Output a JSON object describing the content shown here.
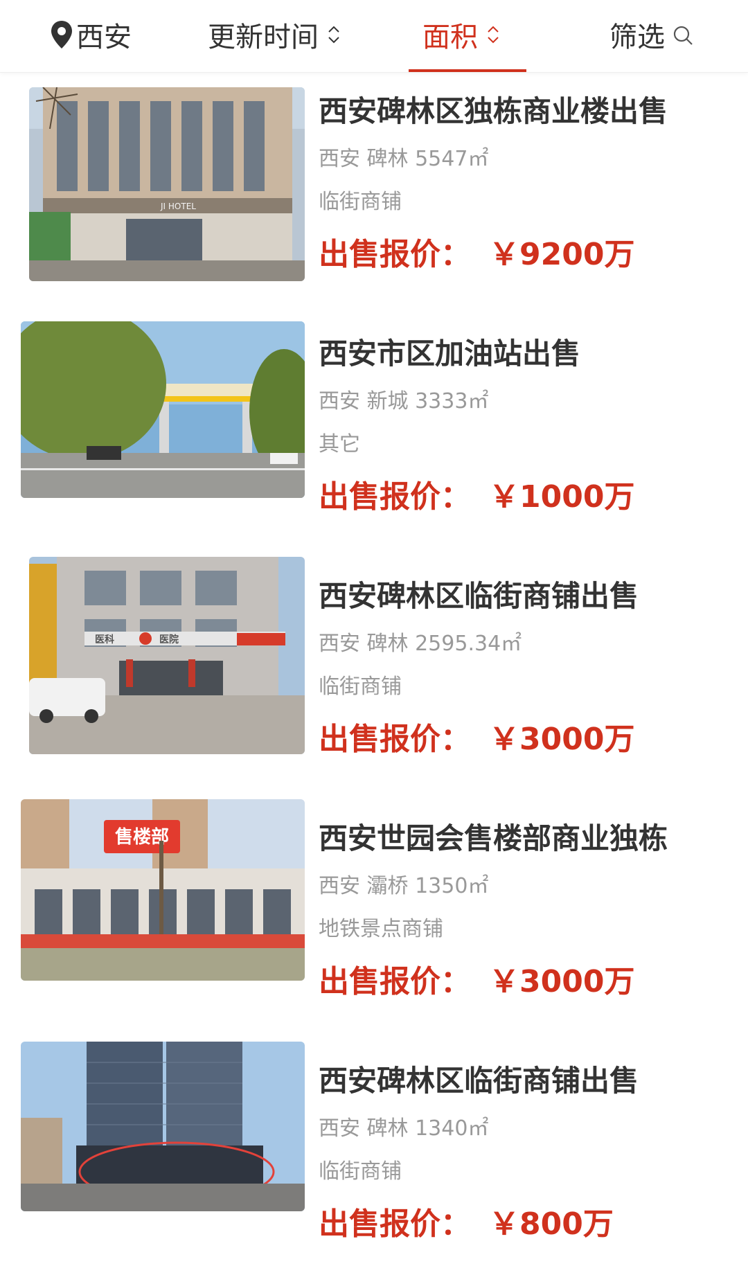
{
  "topbar": {
    "city": "西安",
    "sort_update": "更新时间",
    "sort_area": "面积",
    "filter": "筛选",
    "active_color": "#d0311d"
  },
  "price_label": "出售报价：",
  "listings": [
    {
      "title": "西安碑林区独栋商业楼出售",
      "city": "西安",
      "district": "碑林",
      "area": "5547㎡",
      "type": "临街商铺",
      "price": "￥9200万"
    },
    {
      "title": "西安市区加油站出售",
      "city": "西安",
      "district": "新城",
      "area": "3333㎡",
      "type": "其它",
      "price": "￥1000万"
    },
    {
      "title": "西安碑林区临街商铺出售",
      "city": "西安",
      "district": "碑林",
      "area": "2595.34㎡",
      "type": "临街商铺",
      "price": "￥3000万"
    },
    {
      "title": "西安世园会售楼部商业独栋",
      "city": "西安",
      "district": "灞桥",
      "area": "1350㎡",
      "type": "地铁景点商铺",
      "price": "￥3000万",
      "photo_badge": "售楼部"
    },
    {
      "title": "西安碑林区临街商铺出售",
      "city": "西安",
      "district": "碑林",
      "area": "1340㎡",
      "type": "临街商铺",
      "price": "￥800万"
    }
  ],
  "photo_signage": {
    "hotel": "JI HOTEL",
    "hospital_left": "医科",
    "hospital_right": "医院"
  }
}
